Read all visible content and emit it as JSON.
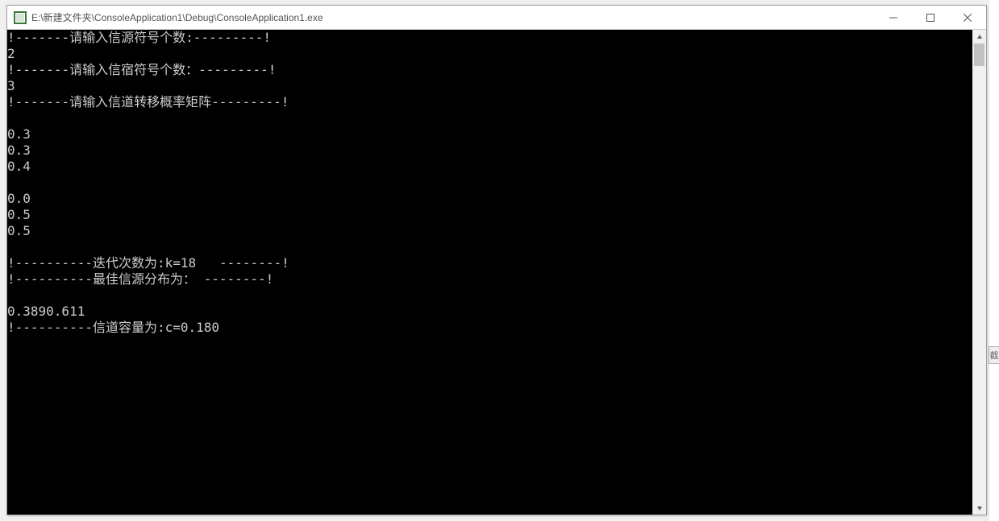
{
  "window": {
    "title": "E:\\新建文件夹\\ConsoleApplication1\\Debug\\ConsoleApplication1.exe"
  },
  "console": {
    "lines": [
      "!-------请输入信源符号个数:---------!",
      "2",
      "!-------请输入信宿符号个数：---------!",
      "3",
      "!-------请输入信道转移概率矩阵---------!",
      "",
      "0.3",
      "0.3",
      "0.4",
      "",
      "0.0",
      "0.5",
      "0.5",
      "",
      "!----------迭代次数为:k=18   --------!",
      "!----------最佳信源分布为： --------!",
      "",
      "0.3890.611",
      "!----------信道容量为:c=0.180"
    ]
  },
  "snip": {
    "label": "截"
  }
}
